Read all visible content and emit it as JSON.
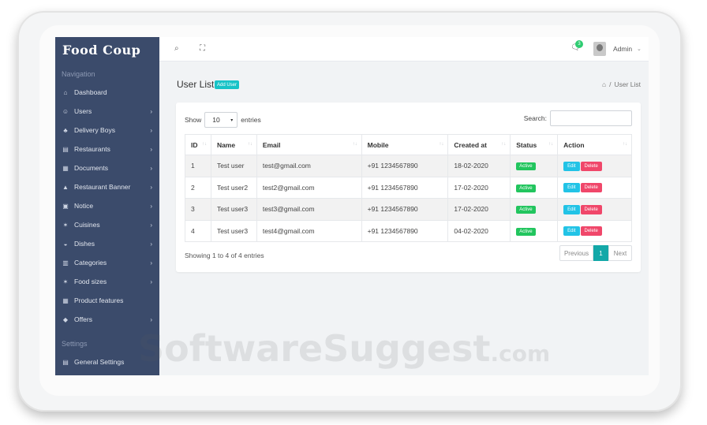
{
  "app": {
    "logo": "Food Coup"
  },
  "sidebar": {
    "nav_heading": "Navigation",
    "items": [
      {
        "label": "Dashboard",
        "icon": "home-icon",
        "chevron": false
      },
      {
        "label": "Users",
        "icon": "user-icon",
        "chevron": true
      },
      {
        "label": "Delivery Boys",
        "icon": "delivery-icon",
        "chevron": true
      },
      {
        "label": "Restaurants",
        "icon": "store-icon",
        "chevron": true
      },
      {
        "label": "Documents",
        "icon": "document-icon",
        "chevron": true
      },
      {
        "label": "Restaurant Banner",
        "icon": "banner-icon",
        "chevron": true
      },
      {
        "label": "Notice",
        "icon": "notice-icon",
        "chevron": true
      },
      {
        "label": "Cuisines",
        "icon": "cuisine-icon",
        "chevron": true
      },
      {
        "label": "Dishes",
        "icon": "dish-icon",
        "chevron": true
      },
      {
        "label": "Categories",
        "icon": "category-icon",
        "chevron": true
      },
      {
        "label": "Food sizes",
        "icon": "size-icon",
        "chevron": true
      },
      {
        "label": "Product features",
        "icon": "feature-icon",
        "chevron": false
      },
      {
        "label": "Offers",
        "icon": "offer-icon",
        "chevron": true
      }
    ],
    "settings_heading": "Settings",
    "settings_items": [
      {
        "label": "General Settings",
        "icon": "settings-icon"
      }
    ]
  },
  "topbar": {
    "notification_count": "3",
    "user_name": "Admin"
  },
  "page": {
    "title": "User List",
    "add_button": "Add User",
    "breadcrumb_current": "User List",
    "breadcrumb_sep": "/"
  },
  "table_controls": {
    "show_label": "Show",
    "entries_value": "10",
    "entries_label": "entries",
    "search_label": "Search:"
  },
  "table": {
    "columns": [
      "ID",
      "Name",
      "Email",
      "Mobile",
      "Created at",
      "Status",
      "Action"
    ],
    "rows": [
      {
        "id": "1",
        "name": "Test user",
        "email": "test@gmail.com",
        "mobile": "+91 1234567890",
        "created": "18-02-2020",
        "status": "Active"
      },
      {
        "id": "2",
        "name": "Test user2",
        "email": "test2@gmail.com",
        "mobile": "+91 1234567890",
        "created": "17-02-2020",
        "status": "Active"
      },
      {
        "id": "3",
        "name": "Test user3",
        "email": "test3@gmail.com",
        "mobile": "+91 1234567890",
        "created": "17-02-2020",
        "status": "Active"
      },
      {
        "id": "4",
        "name": "Test user3",
        "email": "test4@gmail.com",
        "mobile": "+91 1234567890",
        "created": "04-02-2020",
        "status": "Active"
      }
    ],
    "edit_label": "Edit",
    "delete_label": "Delete"
  },
  "footer": {
    "info": "Showing 1 to 4 of 4 entries",
    "prev": "Previous",
    "page": "1",
    "next": "Next"
  },
  "watermark": {
    "main": "SoftwareSuggest",
    "suffix": ".com"
  },
  "colors": {
    "sidebar": "#3b4b6b",
    "accent": "#17c3c7",
    "status_active": "#22c55e",
    "edit": "#22c3e6",
    "delete": "#f0476a"
  }
}
